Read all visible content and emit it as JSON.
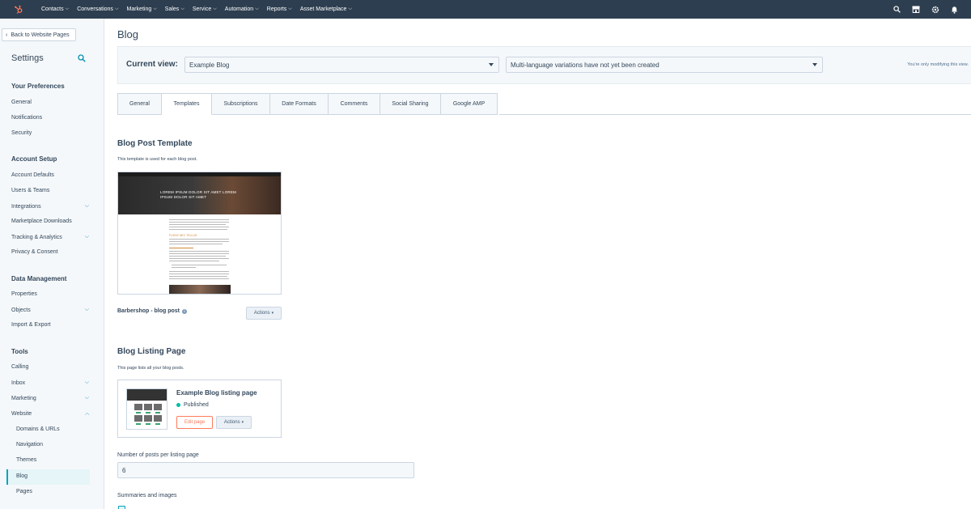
{
  "topnav": {
    "items": [
      "Contacts",
      "Conversations",
      "Marketing",
      "Sales",
      "Service",
      "Automation",
      "Reports",
      "Asset Marketplace"
    ]
  },
  "sidebar": {
    "back_label": "Back to Website Pages",
    "title": "Settings",
    "sections": {
      "preferences": "Your Preferences",
      "account": "Account Setup",
      "data": "Data Management",
      "tools": "Tools"
    },
    "items": {
      "general": "General",
      "notifications": "Notifications",
      "security": "Security",
      "account_defaults": "Account Defaults",
      "users_teams": "Users & Teams",
      "integrations": "Integrations",
      "marketplace_downloads": "Marketplace Downloads",
      "tracking": "Tracking & Analytics",
      "privacy": "Privacy & Consent",
      "properties": "Properties",
      "objects": "Objects",
      "import_export": "Import & Export",
      "calling": "Calling",
      "inbox": "Inbox",
      "marketing": "Marketing",
      "website": "Website",
      "domains": "Domains & URLs",
      "navigation": "Navigation",
      "themes": "Themes",
      "blog": "Blog",
      "pages": "Pages"
    }
  },
  "main": {
    "title": "Blog",
    "current_view_label": "Current view:",
    "blog_select": "Example Blog",
    "language_select": "Multi-language variations have not yet been created",
    "modifying_note": "You're only modifying this view.",
    "tabs": [
      "General",
      "Templates",
      "Subscriptions",
      "Date Formats",
      "Comments",
      "Social Sharing",
      "Google AMP"
    ],
    "active_tab": "Templates",
    "post_template": {
      "heading": "Blog Post Template",
      "desc": "This template is used for each blog post.",
      "preview_hero_text": "LOREM IPSUM DOLOR SIT AMET LOREM IPSUM DOLOR SIT AMET",
      "preview_subheading": "FUSCE NEC TELLUS",
      "name": "Barbershop - blog post",
      "info_glyph": "i",
      "actions_label": "Actions"
    },
    "listing": {
      "heading": "Blog Listing Page",
      "desc": "This page lists all your blog posts.",
      "card_title": "Example Blog listing page",
      "status": "Published",
      "edit_label": "Edit page",
      "actions_label": "Actions"
    },
    "posts_per_page_label": "Number of posts per listing page",
    "posts_per_page_value": "6",
    "summaries_label": "Summaries and images"
  },
  "colors": {
    "nav_bg": "#2d3e50",
    "accent": "#00a4bd",
    "orange": "#ff7a59",
    "published": "#00bda5"
  }
}
